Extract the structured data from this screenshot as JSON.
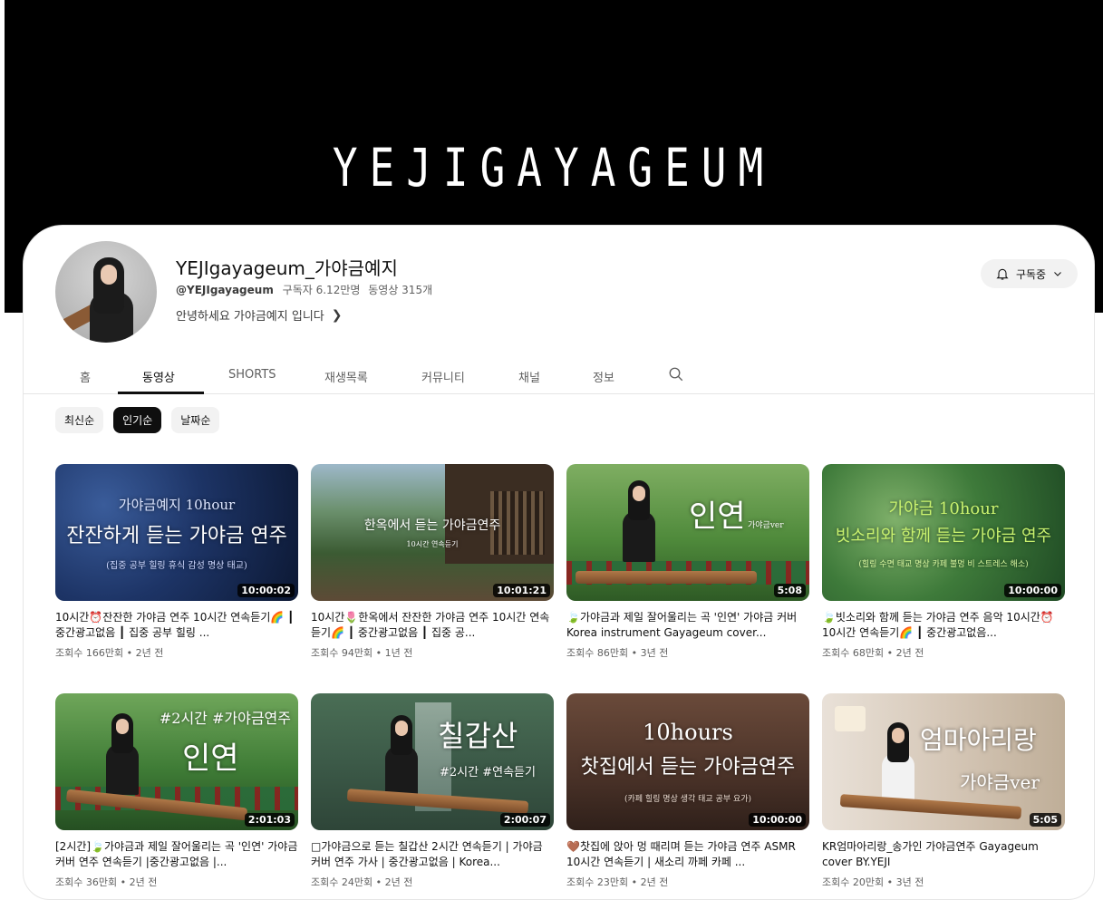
{
  "banner": {
    "title": "YEJIGAYAGEUM"
  },
  "channel": {
    "name": "YEJIgayageum_가야금예지",
    "handle": "@YEJIgayageum",
    "subscribers": "구독자 6.12만명",
    "video_count": "동영상 315개",
    "description": "안녕하세요 가야금예지 입니다",
    "subscribe_label": "구독중"
  },
  "tabs": [
    "홈",
    "동영상",
    "SHORTS",
    "재생목록",
    "커뮤니티",
    "채널",
    "정보"
  ],
  "active_tab": "동영상",
  "chips": [
    "최신순",
    "인기순",
    "날짜순"
  ],
  "active_chip": "인기순",
  "videos": [
    {
      "thumb_line1": "가야금예지 10hour",
      "thumb_line2": "잔잔하게 듣는 가야금 연주",
      "thumb_line3": "(집중 공부 힐링 휴식 감성 명상 태교)",
      "duration": "10:00:02",
      "title": "10시간⏰잔잔한 가야금 연주 10시간 연속듣기🌈 ┃ 중간광고없음 ┃ 집중 공부 힐링 ...",
      "meta": "조회수 166만회 • 2년 전"
    },
    {
      "thumb_line1": "한옥에서 듣는 가야금연주",
      "thumb_line2": "10시간 연속듣기",
      "duration": "10:01:21",
      "title": "10시간🌷한옥에서 잔잔한 가야금 연주 10시간 연속듣기🌈 ┃ 중간광고없음 ┃ 집중 공...",
      "meta": "조회수 94만회 • 1년 전"
    },
    {
      "thumb_line1": "인연",
      "thumb_line2": "가야금ver",
      "duration": "5:08",
      "title": "🍃가야금과 제일 잘어울리는 곡 '인연' 가야금 커버 Korea instrument Gayageum cover...",
      "meta": "조회수 86만회 • 3년 전"
    },
    {
      "thumb_line1": "가야금 10hour",
      "thumb_line2": "빗소리와 함께 듣는 가야금 연주",
      "thumb_line3": "(힐링 수면 태교 명상 카페 불멍 비 스트레스 해소)",
      "duration": "10:00:00",
      "title": "🍃빗소리와 함께 듣는 가야금 연주 음악 10시간⏰10시간 연속듣기🌈 ┃ 중간광고없음...",
      "meta": "조회수 68만회 • 2년 전"
    },
    {
      "thumb_line1": "#2시간 #가야금연주",
      "thumb_line2": "인연",
      "duration": "2:01:03",
      "title": "[2시간]🍃가야금과 제일 잘어울리는 곡 '인연' 가야금 커버 연주 연속듣기 |중간광고없음 |...",
      "meta": "조회수 36만회 • 2년 전"
    },
    {
      "thumb_line1": "칠갑산",
      "thumb_line2": "#2시간 #연속듣기",
      "duration": "2:00:07",
      "title": "□가야금으로 듣는 칠갑산 2시간 연속듣기 | 가야금 커버 연주 가사 | 중간광고없음 | Korea...",
      "meta": "조회수 24만회 • 2년 전"
    },
    {
      "thumb_line1": "10hours",
      "thumb_line2": "찻집에서 듣는 가야금연주",
      "thumb_line3": "(카페 힐링 명상 생각 태교 공부 요가)",
      "duration": "10:00:00",
      "title": "🤎찻집에 앉아 멍 때리며 듣는 가야금 연주 ASMR 10시간 연속듣기 | 새소리 까페 카페 ...",
      "meta": "조회수 23만회 • 2년 전"
    },
    {
      "thumb_line1": "엄마아리랑",
      "thumb_line2": "가야금ver",
      "duration": "5:05",
      "title": "KR엄마아리랑_송가인 가야금연주 Gayageum cover BY.YEJI",
      "meta": "조회수 20만회 • 3년 전"
    }
  ],
  "colors": {
    "banner_bg": "#000000",
    "chip_active": "#0f0f0f",
    "meta_gray": "#606060"
  }
}
